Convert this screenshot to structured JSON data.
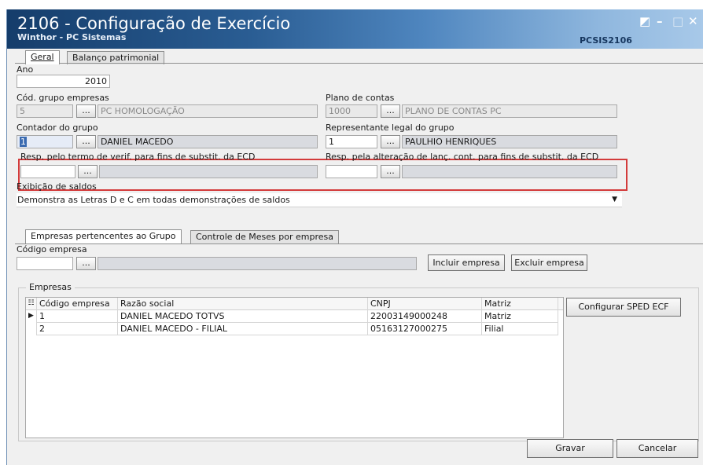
{
  "window": {
    "title": "2106 - Configuração de Exercício",
    "subtitle": "Winthor - PC Sistemas",
    "code": "PCSIS2106",
    "controls": {
      "restore": "◩",
      "minimize": "–",
      "maximize": "□",
      "close": "✕"
    }
  },
  "tabs": [
    {
      "label": "Geral"
    },
    {
      "label": "Balanço patrimonial"
    }
  ],
  "fields": {
    "ano": {
      "label": "Ano",
      "value": "2010"
    },
    "grupo": {
      "label": "Cód. grupo empresas",
      "code": "5",
      "name": "PC HOMOLOGAÇÃO"
    },
    "plano": {
      "label": "Plano de contas",
      "code": "1000",
      "name": "PLANO DE CONTAS PC"
    },
    "contador": {
      "label": "Contador do grupo",
      "code": "1",
      "name": "DANIEL MACEDO"
    },
    "representante": {
      "label": "Representante legal do grupo",
      "code": "1",
      "name": "PAULHIO HENRIQUES"
    },
    "resp_termo": {
      "label": "Resp. pelo termo de verif. para fins de substit. da ECD",
      "code": "",
      "name": ""
    },
    "resp_alteracao": {
      "label": "Resp. pela alteração de lanç. cont. para fins de substit. da ECD",
      "code": "",
      "name": ""
    },
    "exibicao": {
      "label": "Exibição de saldos",
      "value": "Demonstra as Letras D e C em todas demonstrações de saldos"
    },
    "lookup_button": "..."
  },
  "subtabs": [
    {
      "label": "Empresas pertencentes ao Grupo"
    },
    {
      "label": "Controle de Meses por empresa"
    }
  ],
  "empresa": {
    "label": "Código empresa",
    "code": "",
    "name": ""
  },
  "buttons": {
    "incluir": "Incluir empresa",
    "excluir": "Excluir empresa",
    "configurar": "Configurar SPED ECF",
    "gravar": "Gravar",
    "cancelar": "Cancelar"
  },
  "empresas": {
    "label": "Empresas",
    "columns": [
      "Código empresa",
      "Razão social",
      "CNPJ",
      "Matriz"
    ],
    "rows": [
      {
        "codigo": "1",
        "razao": "DANIEL MACEDO TOTVS",
        "cnpj": "22003149000248",
        "matriz": "Matriz"
      },
      {
        "codigo": "2",
        "razao": "DANIEL MACEDO - FILIAL",
        "cnpj": "05163127000275",
        "matriz": "Filial"
      }
    ]
  },
  "colors": {
    "title_dark": "#153d6b",
    "title_light": "#a8c9e9",
    "highlight": "#d33b3b",
    "selection": "#3a6ab0"
  }
}
